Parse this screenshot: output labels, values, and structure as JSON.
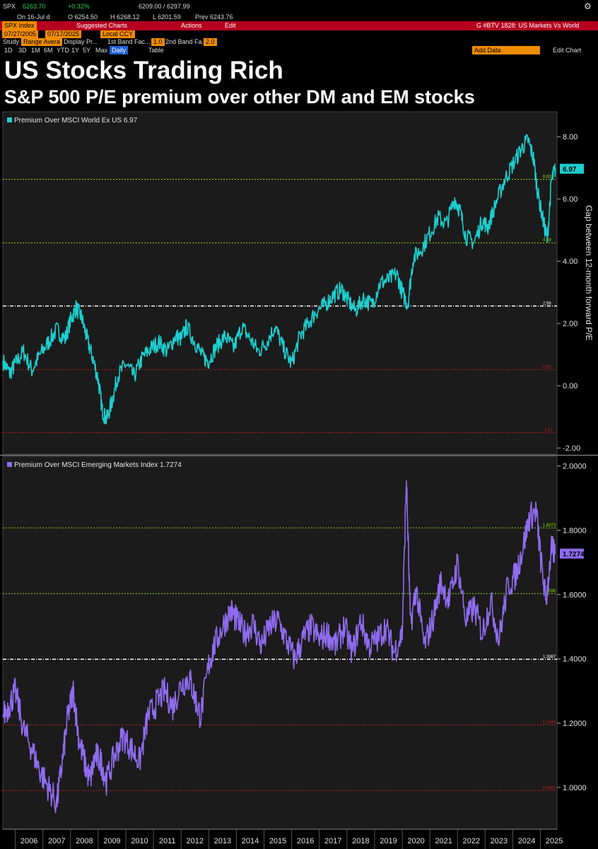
{
  "terminal": {
    "ticker": "SPX",
    "price": "6263.70",
    "change": "+0.32%",
    "range": "6209.00 / 6297.99",
    "on_date": "On 16-Jul d",
    "open": "O 6254.50",
    "high": "H 6268.12",
    "low": "L 6201.59",
    "prev": "Prev 6243.76",
    "security": "SPX Index",
    "suggested": "Suggested Charts",
    "actions": "Actions",
    "edit": "Edit",
    "chart_title": "G #BTV 1828: US Markets Vs World",
    "date_from": "07/27/2005",
    "date_to": "07/17/2025",
    "currency": "Local CCY",
    "study": "Study",
    "study_sel": "Range Avera",
    "display": "Display Pr...",
    "band1": "1st Band Fac...",
    "band1_val": "1.0",
    "band2": "2nd Band Fa...",
    "band2_val": "2.0",
    "ranges": [
      "1D",
      "3D",
      "1M",
      "6M",
      "YTD",
      "1Y",
      "5Y",
      "Max"
    ],
    "freq": "Daily",
    "table": "Table",
    "add_data": "Add Data",
    "edit_chart": "Edit Chart"
  },
  "colors": {
    "series1": "#1ccfd0",
    "series2": "#8f6cf0",
    "green": "#8fe000",
    "red": "#c81e1e",
    "white": "#ffffff"
  },
  "title": "US Stocks Trading Rich",
  "subtitle": "S&P 500 P/E premium over other DM and EM stocks",
  "chart_data": [
    {
      "type": "line",
      "legend": "Premium Over MSCI World Ex US 6.97",
      "ylabel": "Gap between 12-month forward P/E",
      "ylim": [
        -2.2,
        8.8
      ],
      "yticks": [
        -2,
        0,
        2,
        4,
        6,
        8
      ],
      "ytick_labels": [
        "-2.00",
        "0.00",
        "2.00",
        "4.00",
        "6.00",
        "8.00"
      ],
      "last_value": "6.97",
      "levels": [
        {
          "value": 6.63,
          "label": "6.63",
          "color": "green"
        },
        {
          "value": 4.59,
          "label": "4.59",
          "color": "green"
        },
        {
          "value": 2.56,
          "label": "2.56",
          "color": "white"
        },
        {
          "value": 0.52,
          "label": "0.52",
          "color": "red"
        },
        {
          "value": -1.51,
          "label": "-1.51",
          "color": "red"
        }
      ],
      "x": [
        2005.55,
        2005.8,
        2006.0,
        2006.3,
        2006.6,
        2006.9,
        2007.2,
        2007.5,
        2007.8,
        2008.0,
        2008.2,
        2008.4,
        2008.6,
        2008.8,
        2009.0,
        2009.15,
        2009.3,
        2009.5,
        2009.7,
        2010.0,
        2010.3,
        2010.6,
        2010.9,
        2011.2,
        2011.5,
        2011.8,
        2012.0,
        2012.2,
        2012.5,
        2012.8,
        2013.0,
        2013.3,
        2013.6,
        2013.9,
        2014.2,
        2014.5,
        2014.8,
        2015.1,
        2015.4,
        2015.7,
        2016.0,
        2016.3,
        2016.6,
        2016.9,
        2017.2,
        2017.5,
        2017.8,
        2018.0,
        2018.3,
        2018.6,
        2018.9,
        2019.2,
        2019.5,
        2019.8,
        2020.0,
        2020.2,
        2020.4,
        2020.7,
        2021.0,
        2021.3,
        2021.6,
        2021.9,
        2022.1,
        2022.3,
        2022.6,
        2022.9,
        2023.1,
        2023.4,
        2023.7,
        2024.0,
        2024.3,
        2024.55,
        2024.75,
        2024.9,
        2025.1,
        2025.25,
        2025.4,
        2025.54
      ],
      "values": [
        0.8,
        0.4,
        0.7,
        1.1,
        0.5,
        1.0,
        1.4,
        1.8,
        1.5,
        2.1,
        2.5,
        2.2,
        1.5,
        0.9,
        0.2,
        -0.8,
        -1.1,
        -0.5,
        0.3,
        0.7,
        0.3,
        0.9,
        1.2,
        1.4,
        1.1,
        1.6,
        1.5,
        1.9,
        1.4,
        0.9,
        0.8,
        1.3,
        1.6,
        1.2,
        1.9,
        1.5,
        1.1,
        1.4,
        1.9,
        1.2,
        0.7,
        1.6,
        2.0,
        2.4,
        2.6,
        2.9,
        3.1,
        2.8,
        2.4,
        2.8,
        2.6,
        3.3,
        3.4,
        3.6,
        3.0,
        2.6,
        4.1,
        4.4,
        4.9,
        5.4,
        5.2,
        6.0,
        5.6,
        4.8,
        4.6,
        5.3,
        5.1,
        5.9,
        6.6,
        7.1,
        7.6,
        7.9,
        7.3,
        6.2,
        5.3,
        4.7,
        6.6,
        6.97
      ]
    },
    {
      "type": "line",
      "legend": "Premium Over MSCI Emerging Markets Index 1.7274",
      "ylim": [
        0.87,
        2.03
      ],
      "yticks": [
        1.0,
        1.2,
        1.4,
        1.6,
        1.8,
        2.0
      ],
      "ytick_labels": [
        "1.0000",
        "1.2000",
        "1.4000",
        "1.6000",
        "1.8000",
        "2.0000"
      ],
      "last_value": "1.7274",
      "levels": [
        {
          "value": 1.8073,
          "label": "1.8073",
          "color": "green"
        },
        {
          "value": 1.603,
          "label": "1.6030",
          "color": "green"
        },
        {
          "value": 1.3987,
          "label": "1.3987",
          "color": "white"
        },
        {
          "value": 1.1944,
          "label": "1.1944",
          "color": "red"
        },
        {
          "value": 0.9901,
          "label": "0.9901",
          "color": "red"
        }
      ],
      "x": [
        2005.55,
        2005.8,
        2006.0,
        2006.3,
        2006.6,
        2006.9,
        2007.2,
        2007.5,
        2007.7,
        2007.9,
        2008.1,
        2008.3,
        2008.5,
        2008.7,
        2008.9,
        2009.1,
        2009.3,
        2009.6,
        2009.9,
        2010.2,
        2010.5,
        2010.8,
        2011.1,
        2011.4,
        2011.7,
        2012.0,
        2012.3,
        2012.5,
        2012.7,
        2013.0,
        2013.2,
        2013.5,
        2013.8,
        2014.0,
        2014.3,
        2014.6,
        2014.9,
        2015.2,
        2015.5,
        2015.8,
        2016.1,
        2016.4,
        2016.7,
        2017.0,
        2017.3,
        2017.6,
        2017.9,
        2018.2,
        2018.5,
        2018.8,
        2019.1,
        2019.4,
        2019.7,
        2020.0,
        2020.15,
        2020.3,
        2020.5,
        2020.8,
        2021.1,
        2021.4,
        2021.7,
        2022.0,
        2022.3,
        2022.6,
        2022.9,
        2023.2,
        2023.5,
        2023.8,
        2024.1,
        2024.35,
        2024.6,
        2024.85,
        2025.0,
        2025.2,
        2025.4,
        2025.54
      ],
      "values": [
        1.22,
        1.26,
        1.3,
        1.18,
        1.12,
        1.05,
        1.0,
        0.95,
        1.08,
        1.22,
        1.3,
        1.15,
        1.08,
        1.02,
        1.1,
        1.08,
        1.02,
        1.1,
        1.16,
        1.12,
        1.08,
        1.22,
        1.26,
        1.3,
        1.25,
        1.32,
        1.34,
        1.28,
        1.22,
        1.38,
        1.44,
        1.5,
        1.55,
        1.52,
        1.48,
        1.51,
        1.44,
        1.5,
        1.52,
        1.46,
        1.4,
        1.46,
        1.5,
        1.46,
        1.48,
        1.44,
        1.5,
        1.42,
        1.52,
        1.44,
        1.46,
        1.5,
        1.42,
        1.48,
        1.96,
        1.5,
        1.62,
        1.44,
        1.52,
        1.64,
        1.58,
        1.7,
        1.52,
        1.56,
        1.48,
        1.58,
        1.46,
        1.62,
        1.66,
        1.74,
        1.84,
        1.86,
        1.72,
        1.58,
        1.74,
        1.7274
      ]
    }
  ],
  "x_axis": {
    "xlim": [
      2005.55,
      2025.6
    ],
    "labels": [
      "2006",
      "2007",
      "2008",
      "2009",
      "2010",
      "2011",
      "2012",
      "2013",
      "2014",
      "2015",
      "2016",
      "2017",
      "2018",
      "2019",
      "2020",
      "2021",
      "2022",
      "2023",
      "2024",
      "2025"
    ]
  }
}
